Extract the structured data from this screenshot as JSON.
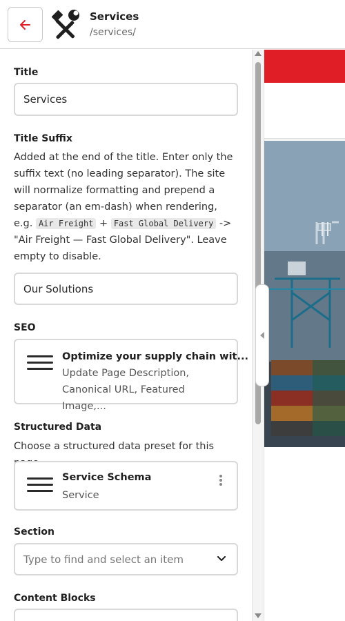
{
  "header": {
    "title": "Services",
    "path": "/services/",
    "back_icon": "arrow-left-icon",
    "doc_icon": "hammer-wrench-icon",
    "accent": "#e01e26"
  },
  "form": {
    "title": {
      "label": "Title",
      "value": "Services"
    },
    "title_suffix": {
      "label": "Title Suffix",
      "desc_before": "Added at the end of the title. Enter only the suffix text (no leading separator). The site will normalize formatting and prepend a separator (an em-dash) when rendering, e.g. ",
      "example_1": "Air Freight",
      "plus": " + ",
      "example_2": "Fast Global Delivery",
      "desc_after": " -> \"Air Freight — Fast Global Delivery\". Leave empty to disable.",
      "value": "Our Solutions"
    },
    "seo": {
      "label": "SEO",
      "card_title": "Optimize your supply chain wit...",
      "card_sub": "Update Page Description, Canonical URL, Featured Image,..."
    },
    "structured_data": {
      "label": "Structured Data",
      "desc": "Choose a structured data preset for this page",
      "card_title": "Service Schema",
      "card_sub": "Service"
    },
    "section": {
      "label": "Section",
      "placeholder": "Type to find and select an item"
    },
    "content_blocks": {
      "label": "Content Blocks"
    }
  }
}
